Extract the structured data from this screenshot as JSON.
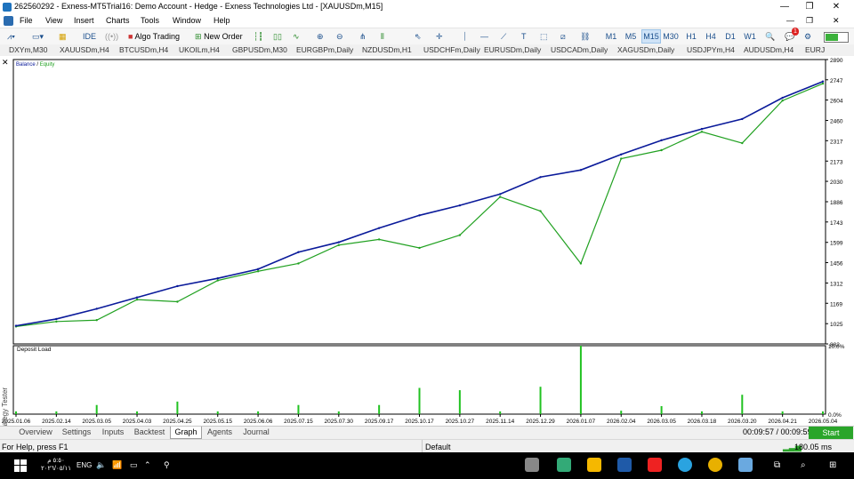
{
  "window": {
    "title": "262560292 - Exness-MT5Trial16: Demo Account - Hedge - Exness Technologies Ltd - [XAUUSDm,M15]",
    "controls": [
      "—",
      "❐",
      "✕"
    ]
  },
  "menu": [
    "File",
    "View",
    "Insert",
    "Charts",
    "Tools",
    "Window",
    "Help"
  ],
  "toolbar": {
    "ide_label": "IDE",
    "algo_label": "Algo Trading",
    "neworder_label": "New Order",
    "timeframes": [
      "M1",
      "M5",
      "M15",
      "M30",
      "H1",
      "H4",
      "D1",
      "W1"
    ],
    "active_timeframe": "M15",
    "notification_count": "1"
  },
  "symbol_tabs": [
    "DXYm,M30",
    "XAUUSDm,H4",
    "BTCUSDm,H4",
    "UKOILm,H4",
    "GBPUSDm,M30",
    "EURGBPm,Daily",
    "NZDUSDm,H1",
    "USDCHFm,Daily",
    "EURUSDm,Daily",
    "USDCADm,Daily",
    "XAGUSDm,Daily",
    "USDJPYm,H4",
    "AUDUSDm,H4",
    "EURJ"
  ],
  "chart_data": {
    "type": "line",
    "title": "",
    "legend": [
      "Balance",
      "Equity"
    ],
    "legend_separator": "/",
    "y_ticks": [
      "2890",
      "2747",
      "2604",
      "2460",
      "2317",
      "2173",
      "2030",
      "1886",
      "1743",
      "1599",
      "1456",
      "1312",
      "1169",
      "1025",
      "882"
    ],
    "ylim": [
      882,
      2890
    ],
    "series": [
      {
        "name": "Balance",
        "color": "#0a1a9a",
        "values": [
          {
            "x": "2025.01.06",
            "y": 1010
          },
          {
            "x": "2025.02.14",
            "y": 1058
          },
          {
            "x": "2025.03.05",
            "y": 1130
          },
          {
            "x": "2025.04.03",
            "y": 1210
          },
          {
            "x": "2025.04.25",
            "y": 1290
          },
          {
            "x": "2025.05.15",
            "y": 1345
          },
          {
            "x": "2025.06.06",
            "y": 1410
          },
          {
            "x": "2025.07.15",
            "y": 1530
          },
          {
            "x": "2025.07.30",
            "y": 1600
          },
          {
            "x": "2025.09.17",
            "y": 1700
          },
          {
            "x": "2025.10.17",
            "y": 1790
          },
          {
            "x": "2025.10.27",
            "y": 1860
          },
          {
            "x": "2025.11.14",
            "y": 1940
          },
          {
            "x": "2025.12.29",
            "y": 2060
          },
          {
            "x": "2026.01.07",
            "y": 2110
          },
          {
            "x": "2026.02.04",
            "y": 2220
          },
          {
            "x": "2026.03.05",
            "y": 2320
          },
          {
            "x": "2026.03.18",
            "y": 2400
          },
          {
            "x": "2026.03.20",
            "y": 2470
          },
          {
            "x": "2026.04.21",
            "y": 2620
          },
          {
            "x": "2026.05.04",
            "y": 2735
          }
        ]
      },
      {
        "name": "Equity",
        "color": "#21a121",
        "values": [
          {
            "x": "2025.01.06",
            "y": 1005
          },
          {
            "x": "2025.02.14",
            "y": 1040
          },
          {
            "x": "2025.03.05",
            "y": 1050
          },
          {
            "x": "2025.04.03",
            "y": 1195
          },
          {
            "x": "2025.04.25",
            "y": 1180
          },
          {
            "x": "2025.05.15",
            "y": 1330
          },
          {
            "x": "2025.06.06",
            "y": 1395
          },
          {
            "x": "2025.07.15",
            "y": 1450
          },
          {
            "x": "2025.07.30",
            "y": 1580
          },
          {
            "x": "2025.09.17",
            "y": 1620
          },
          {
            "x": "2025.10.17",
            "y": 1560
          },
          {
            "x": "2025.10.27",
            "y": 1650
          },
          {
            "x": "2025.11.14",
            "y": 1920
          },
          {
            "x": "2025.12.29",
            "y": 1820
          },
          {
            "x": "2026.01.07",
            "y": 1450
          },
          {
            "x": "2026.02.04",
            "y": 2190
          },
          {
            "x": "2026.03.05",
            "y": 2250
          },
          {
            "x": "2026.03.18",
            "y": 2380
          },
          {
            "x": "2026.03.20",
            "y": 2300
          },
          {
            "x": "2026.04.21",
            "y": 2600
          },
          {
            "x": "2026.05.04",
            "y": 2720
          }
        ]
      }
    ],
    "x_ticks": [
      "2025.01.06",
      "2025.02.14",
      "2025.03.05",
      "2025.04.03",
      "2025.04.25",
      "2025.05.15",
      "2025.06.06",
      "2025.07.15",
      "2025.07.30",
      "2025.09.17",
      "2025.10.17",
      "2025.10.27",
      "2025.11.14",
      "2025.12.29",
      "2026.01.07",
      "2026.02.04",
      "2026.03.05",
      "2026.03.18",
      "2026.03.20",
      "2026.04.21",
      "2026.05.04"
    ],
    "deposit_load": {
      "label": "Deposit Load",
      "y_ticks": [
        "10.0%",
        "0.0%"
      ],
      "ylim": [
        0,
        10
      ],
      "bar_color": "#21c221"
    }
  },
  "side_label": "Strategy Tester",
  "bottom_tabs": [
    "Overview",
    "Settings",
    "Inputs",
    "Backtest",
    "Graph",
    "Agents",
    "Journal"
  ],
  "active_bottom_tab": "Graph",
  "timer": "00:09:57 / 00:09:59",
  "start_label": "Start",
  "status": {
    "help": "For Help, press F1",
    "profile": "Default",
    "ping": "180.05 ms"
  },
  "taskbar": {
    "language": "ENG",
    "clock_time": "٥:٥٠ م",
    "clock_date": "٢٠٢٦/٠٥/١١"
  }
}
